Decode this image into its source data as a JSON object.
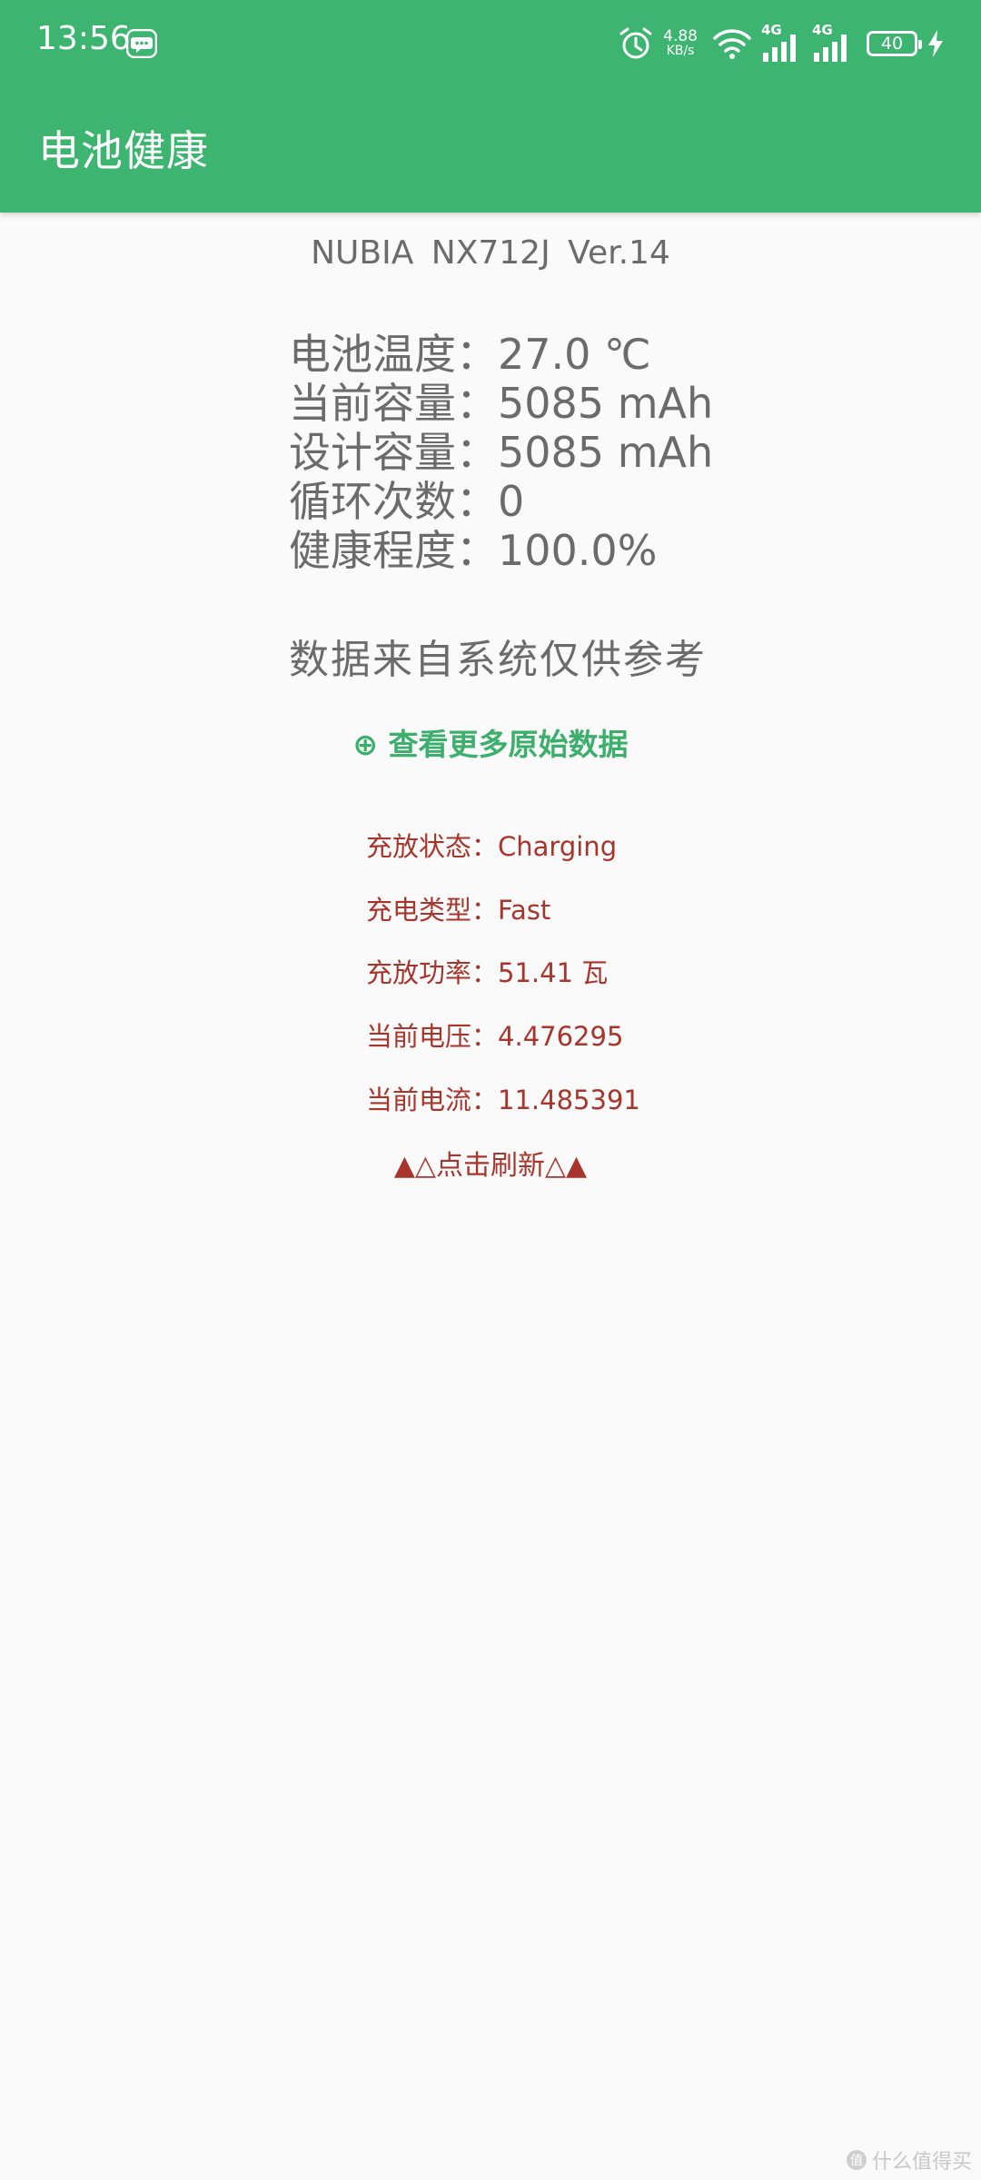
{
  "status_bar": {
    "time": "13:56",
    "net_speed_value": "4.88",
    "net_speed_unit": "KB/s",
    "signal1_tag": "4G",
    "signal2_tag": "4G",
    "battery_level": "40",
    "icons": [
      "message-icon",
      "alarm-icon",
      "wifi-icon",
      "signal-icon",
      "signal-icon",
      "battery-icon",
      "charging-bolt-icon"
    ]
  },
  "app_bar": {
    "title": "电池健康"
  },
  "device": {
    "line": "NUBIA  NX712J  Ver.14"
  },
  "stats": [
    {
      "label": "电池温度",
      "sep": "：",
      "value": "27.0 ℃"
    },
    {
      "label": "当前容量",
      "sep": "：",
      "value": "5085 mAh"
    },
    {
      "label": "设计容量",
      "sep": "：",
      "value": "5085 mAh"
    },
    {
      "label": "循环次数",
      "sep": "：",
      "value": "0"
    },
    {
      "label": "健康程度",
      "sep": "：",
      "value": "100.0%"
    }
  ],
  "disclaimer": "数据来自系统仅供参考",
  "more_link": "⊕ 查看更多原始数据",
  "details": [
    {
      "label": "充放状态",
      "sep": "：",
      "value": "Charging"
    },
    {
      "label": "充电类型",
      "sep": "：",
      "value": "Fast"
    },
    {
      "label": "充放功率",
      "sep": "：",
      "value": "51.41 瓦"
    },
    {
      "label": "当前电压",
      "sep": "：",
      "value": "4.476295"
    },
    {
      "label": "当前电流",
      "sep": "：",
      "value": "11.485391"
    }
  ],
  "refresh": "▲△点击刷新△▲",
  "watermark": {
    "badge": "值",
    "text": "什么值得买"
  },
  "colors": {
    "primary_green": "#3db571",
    "link_green": "#3daf6c",
    "text_gray": "#6b6b6b",
    "detail_red": "#a8352c",
    "background": "#fafafa"
  }
}
